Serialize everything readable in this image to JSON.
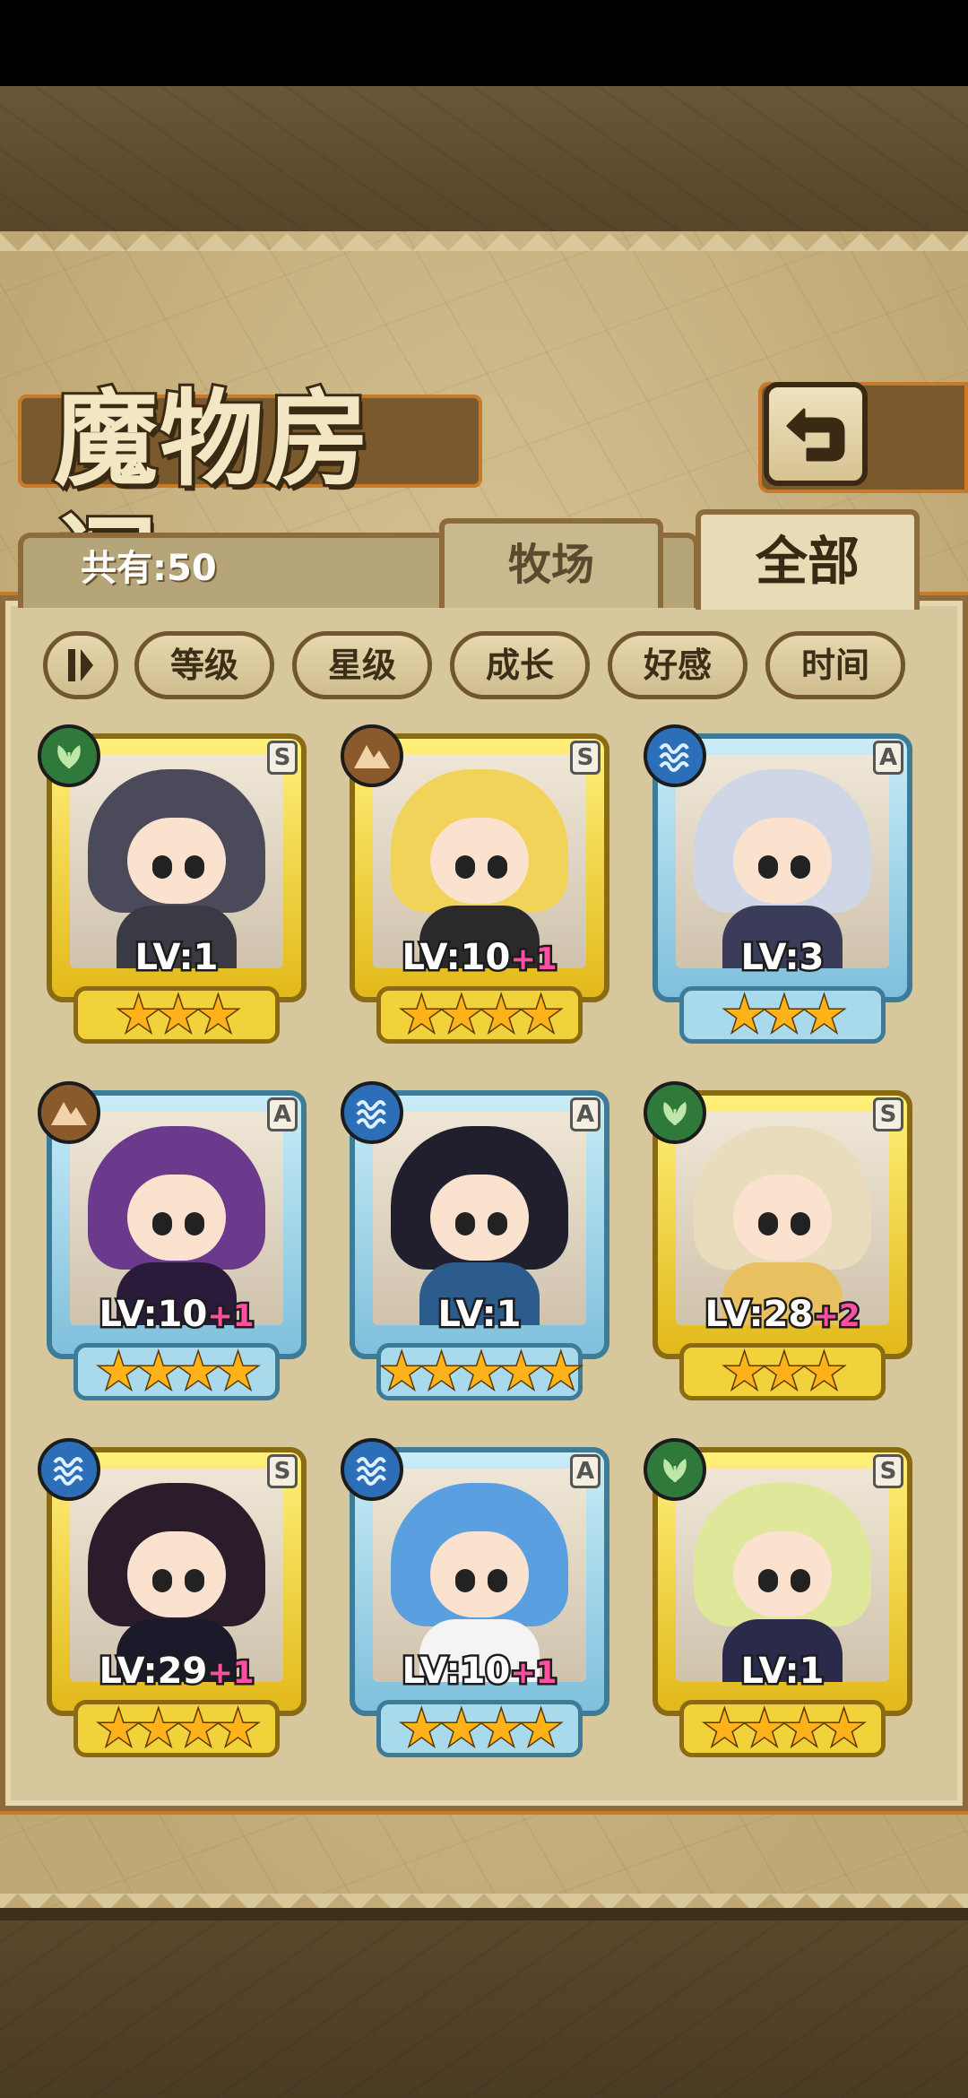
{
  "title": "魔物房间",
  "header": {
    "total_label": "共有:50"
  },
  "tabs": {
    "ranch": "牧场",
    "all": "全部"
  },
  "sort": {
    "toggle_icon": "sort-toggle-icon",
    "buttons": [
      "等级",
      "星级",
      "成长",
      "好感",
      "时间"
    ]
  },
  "monsters": [
    {
      "element": "grass",
      "rank": "S",
      "level": "LV:1",
      "bonus": "",
      "stars": "★★★",
      "frame": "gold"
    },
    {
      "element": "earth",
      "rank": "S",
      "level": "LV:10",
      "bonus": "+1",
      "stars": "★★★★",
      "frame": "gold"
    },
    {
      "element": "water",
      "rank": "A",
      "level": "LV:3",
      "bonus": "",
      "stars": "★★★",
      "frame": "blue"
    },
    {
      "element": "earth",
      "rank": "A",
      "level": "LV:10",
      "bonus": "+1",
      "stars": "★★★★",
      "frame": "blue"
    },
    {
      "element": "water",
      "rank": "A",
      "level": "LV:1",
      "bonus": "",
      "stars": "★★★★★",
      "frame": "blue"
    },
    {
      "element": "grass",
      "rank": "S",
      "level": "LV:28",
      "bonus": "+2",
      "stars": "★★★",
      "frame": "gold"
    },
    {
      "element": "water",
      "rank": "S",
      "level": "LV:29",
      "bonus": "+1",
      "stars": "★★★★",
      "frame": "gold"
    },
    {
      "element": "water",
      "rank": "A",
      "level": "LV:10",
      "bonus": "+1",
      "stars": "★★★★",
      "frame": "blue"
    },
    {
      "element": "grass",
      "rank": "S",
      "level": "LV:1",
      "bonus": "",
      "stars": "★★★★",
      "frame": "gold"
    }
  ],
  "colors": {
    "gold_frame": "#e2b91a",
    "blue_frame": "#7fc0dc",
    "bonus": "#ff4fa3",
    "parchment": "#d9c89b"
  }
}
